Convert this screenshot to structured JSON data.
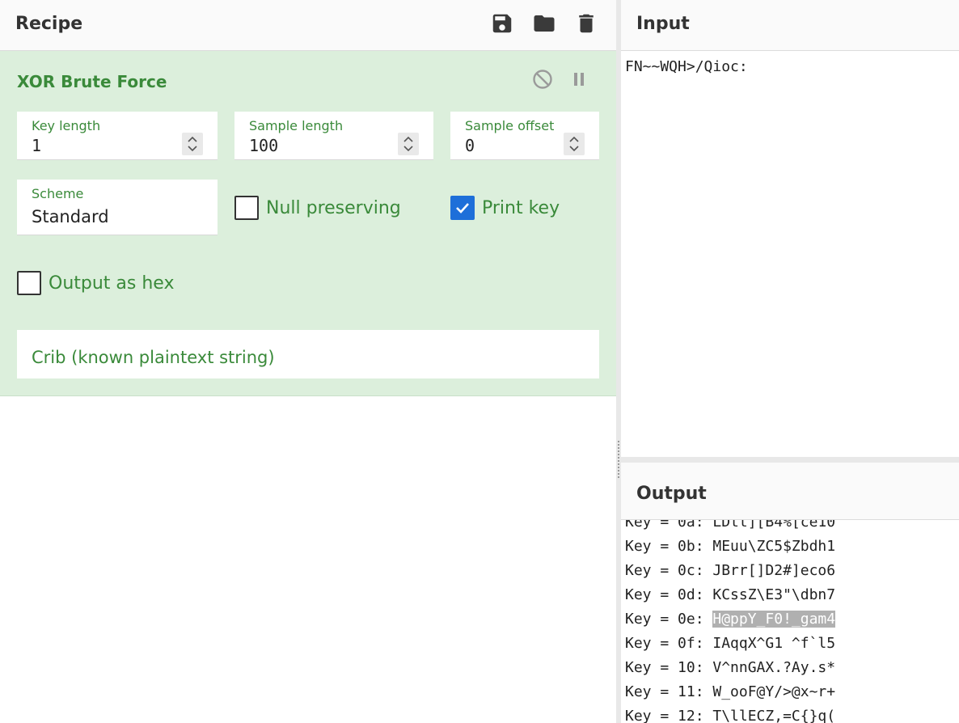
{
  "recipe": {
    "title": "Recipe",
    "icons": [
      "save-icon",
      "folder-open-icon",
      "trash-icon"
    ]
  },
  "operation": {
    "title": "XOR Brute Force",
    "fields": {
      "key_length": {
        "label": "Key length",
        "value": "1"
      },
      "sample_length": {
        "label": "Sample length",
        "value": "100"
      },
      "sample_offset": {
        "label": "Sample offset",
        "value": "0"
      },
      "scheme": {
        "label": "Scheme",
        "value": "Standard"
      }
    },
    "checkboxes": {
      "null_preserving": {
        "label": "Null preserving",
        "checked": false
      },
      "print_key": {
        "label": "Print key",
        "checked": true
      },
      "output_as_hex": {
        "label": "Output as hex",
        "checked": false
      }
    },
    "crib": {
      "placeholder": "Crib (known plaintext string)"
    }
  },
  "input": {
    "title": "Input",
    "text": "FN~~WQH>/Qioc:"
  },
  "output": {
    "title": "Output",
    "lines": [
      {
        "prefix": "Key = 0a: ",
        "text": "LDtt][B4%[ce10"
      },
      {
        "prefix": "Key = 0b: ",
        "text": "MEuu\\ZC5$Zbdh1"
      },
      {
        "prefix": "Key = 0c: ",
        "text": "JBrr[]D2#]eco6"
      },
      {
        "prefix": "Key = 0d: ",
        "text": "KCssZ\\E3\"\\dbn7"
      },
      {
        "prefix": "Key = 0e: ",
        "text": "H@ppY_F0!_gam4"
      },
      {
        "prefix": "Key = 0f: ",
        "text": "IAqqX^G1 ^f`l5"
      },
      {
        "prefix": "Key = 10: ",
        "text": "V^nnGAX.?Ay.s*"
      },
      {
        "prefix": "Key = 11: ",
        "text": "W_ooF@Y/>@x~r+"
      },
      {
        "prefix": "Key = 12: ",
        "text": "T\\llECZ,=C{}q("
      }
    ],
    "highlighted_line_index": 4
  },
  "colors": {
    "operation_bg": "#dcefdc",
    "accent_green": "#3a8a3a",
    "checkbox_checked": "#1e6fd9",
    "highlight": "#b0b0b0"
  }
}
